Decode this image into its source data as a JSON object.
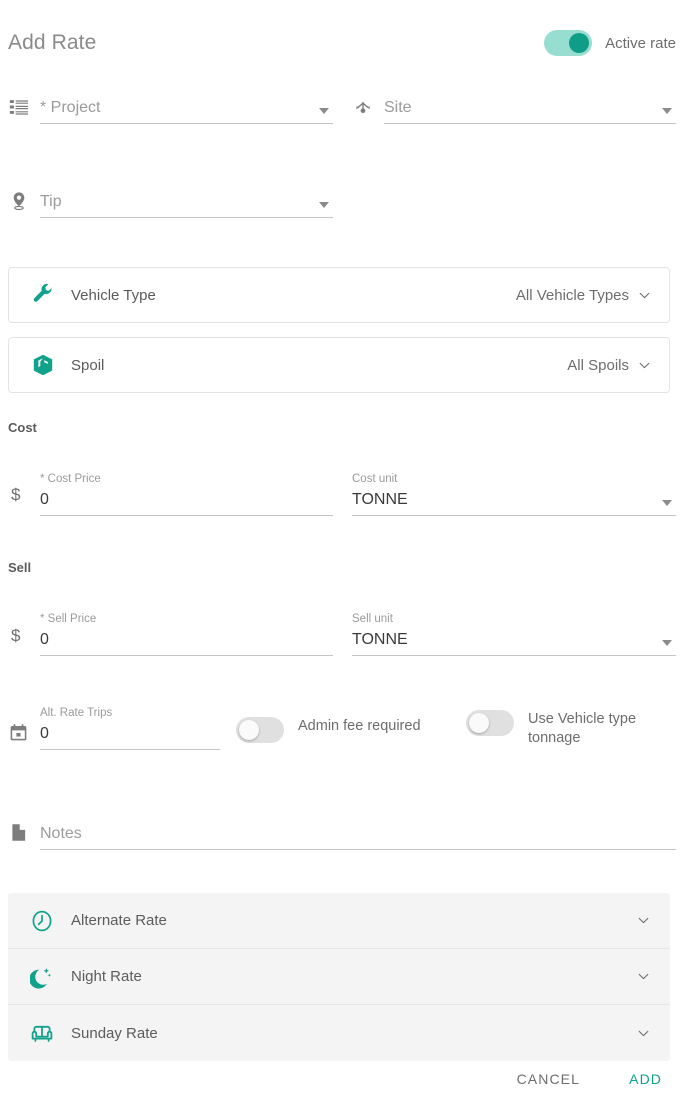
{
  "header": {
    "title": "Add Rate",
    "active_toggle_label": "Active rate",
    "active_toggle_on": true
  },
  "colors": {
    "accent": "#12a28c",
    "toggle_on_track": "#97ded0",
    "toggle_on_knob": "#0f9d87",
    "toggle_off_track": "#e0e0e0",
    "text_primary": "#3b3b3b",
    "text_secondary": "#6d6d6d",
    "text_muted": "#9b9b9b",
    "card_border": "#e3e3e3",
    "accordion_bg": "#f4f4f4"
  },
  "fields": {
    "project": {
      "label": "",
      "placeholder": "* Project",
      "value": "",
      "icon": "list-icon"
    },
    "site": {
      "label": "",
      "placeholder": "Site",
      "value": "",
      "icon": "site-network-icon"
    },
    "tip": {
      "label": "",
      "placeholder": "Tip",
      "value": "",
      "icon": "map-pin-icon"
    },
    "notes": {
      "label": "",
      "placeholder": "Notes",
      "value": "",
      "icon": "document-icon"
    }
  },
  "selectors": [
    {
      "label": "Vehicle Type",
      "value": "All Vehicle Types",
      "icon": "wrench-icon"
    },
    {
      "label": "Spoil",
      "value": "All Spoils",
      "icon": "cube-icon"
    }
  ],
  "cost": {
    "section_label": "Cost",
    "currency_symbol": "$",
    "price": {
      "label": "* Cost Price",
      "value": "0"
    },
    "unit": {
      "label": "Cost unit",
      "value": "TONNE"
    }
  },
  "sell": {
    "section_label": "Sell",
    "currency_symbol": "$",
    "price": {
      "label": "* Sell Price",
      "value": "0"
    },
    "unit": {
      "label": "Sell unit",
      "value": "TONNE"
    }
  },
  "options": {
    "alt_rate_trips": {
      "label": "Alt. Rate Trips",
      "value": "0",
      "icon": "calendar-icon"
    },
    "admin_fee": {
      "label": "Admin fee required",
      "on": false
    },
    "vehicle_tonnage": {
      "label": "Use Vehicle type tonnage",
      "on": false
    }
  },
  "accordions": [
    {
      "label": "Alternate Rate",
      "icon": "clock-icon",
      "expanded": false
    },
    {
      "label": "Night Rate",
      "icon": "moon-star-icon",
      "expanded": false
    },
    {
      "label": "Sunday Rate",
      "icon": "sofa-icon",
      "expanded": false
    }
  ],
  "footer": {
    "cancel_label": "CANCEL",
    "add_label": "ADD"
  }
}
